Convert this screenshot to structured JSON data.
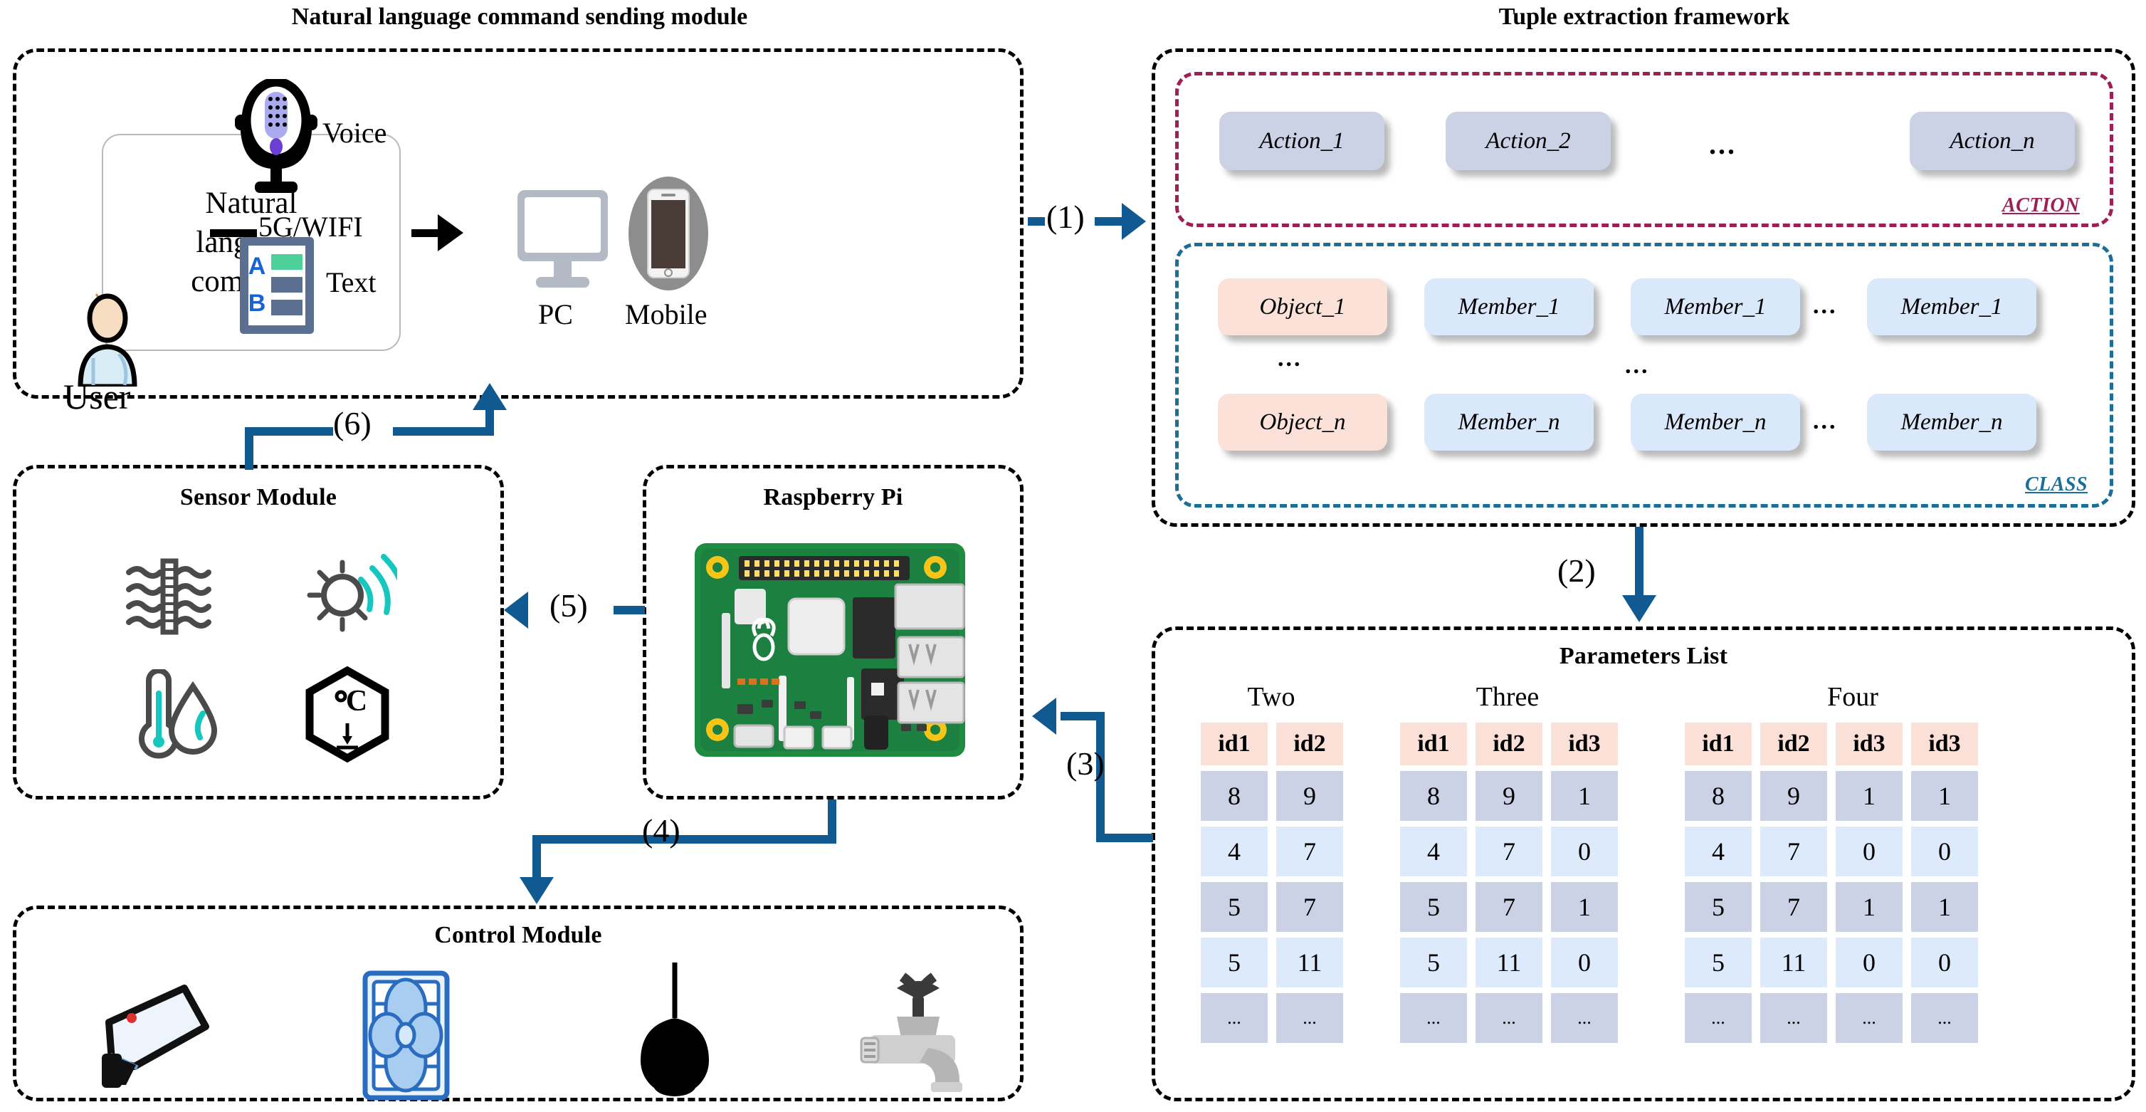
{
  "modules": {
    "nl": {
      "title": "Natural language command sending module"
    },
    "tuple": {
      "title": "Tuple extraction framework"
    },
    "sensor": {
      "title": "Sensor Module"
    },
    "rpi": {
      "title": "Raspberry Pi"
    },
    "control": {
      "title": "Control Module"
    },
    "params": {
      "title": "Parameters List"
    }
  },
  "nl_module": {
    "command_box": "Natural\nlanguage\ncommand",
    "user_label": "User",
    "voice_label": "Voice",
    "text_label": "Text",
    "link_label": "5G/WIFI",
    "pc_label": "PC",
    "mobile_label": "Mobile"
  },
  "tuple_framework": {
    "action_tag": "ACTION",
    "class_tag": "CLASS",
    "actions": [
      "Action_1",
      "Action_2",
      "...",
      "Action_n"
    ],
    "class_rows": [
      [
        "Object_1",
        "Member_1",
        "Member_1",
        "...",
        "Member_1"
      ],
      [
        "...",
        "",
        "...",
        "",
        ""
      ],
      [
        "Object_n",
        "Member_n",
        "Member_n",
        "...",
        "Member_n"
      ]
    ],
    "ellipsis": "..."
  },
  "parameters_list": {
    "groups": [
      {
        "name": "Two",
        "headers": [
          "id1",
          "id2"
        ]
      },
      {
        "name": "Three",
        "headers": [
          "id1",
          "id2",
          "id3"
        ]
      },
      {
        "name": "Four",
        "headers": [
          "id1",
          "id2",
          "id3",
          "id3"
        ]
      }
    ],
    "rows_two": [
      [
        "8",
        "9"
      ],
      [
        "4",
        "7"
      ],
      [
        "5",
        "7"
      ],
      [
        "5",
        "11"
      ],
      [
        "...",
        "..."
      ]
    ],
    "rows_three": [
      [
        "8",
        "9",
        "1"
      ],
      [
        "4",
        "7",
        "0"
      ],
      [
        "5",
        "7",
        "1"
      ],
      [
        "5",
        "11",
        "0"
      ],
      [
        "...",
        "...",
        "..."
      ]
    ],
    "rows_four": [
      [
        "8",
        "9",
        "1",
        "1"
      ],
      [
        "4",
        "7",
        "0",
        "0"
      ],
      [
        "5",
        "7",
        "1",
        "1"
      ],
      [
        "5",
        "11",
        "0",
        "0"
      ],
      [
        "...",
        "...",
        "...",
        "..."
      ]
    ]
  },
  "connectors": {
    "c1": "(1)",
    "c2": "(2)",
    "c3": "(3)",
    "c4": "(4)",
    "c5": "(5)",
    "c6": "(6)"
  },
  "sensor_icons": [
    "air-flow-sensor-icon",
    "light-sensor-icon",
    "temperature-humidity-sensor-icon",
    "temperature-probe-sensor-icon"
  ],
  "control_icons": [
    "security-camera-icon",
    "ventilation-fan-icon",
    "pendant-lamp-icon",
    "water-tap-icon"
  ],
  "colors": {
    "action_chip": "#ccd2e6",
    "object_chip": "#fbe1d8",
    "member_chip": "#d9e8fb",
    "action_border": "#9e1f54",
    "class_border": "#1b6e96",
    "arrow": "#115a91",
    "header_cell": "#fbe0d8",
    "row_a": "#ccd2e6",
    "row_b": "#ddeafc"
  }
}
